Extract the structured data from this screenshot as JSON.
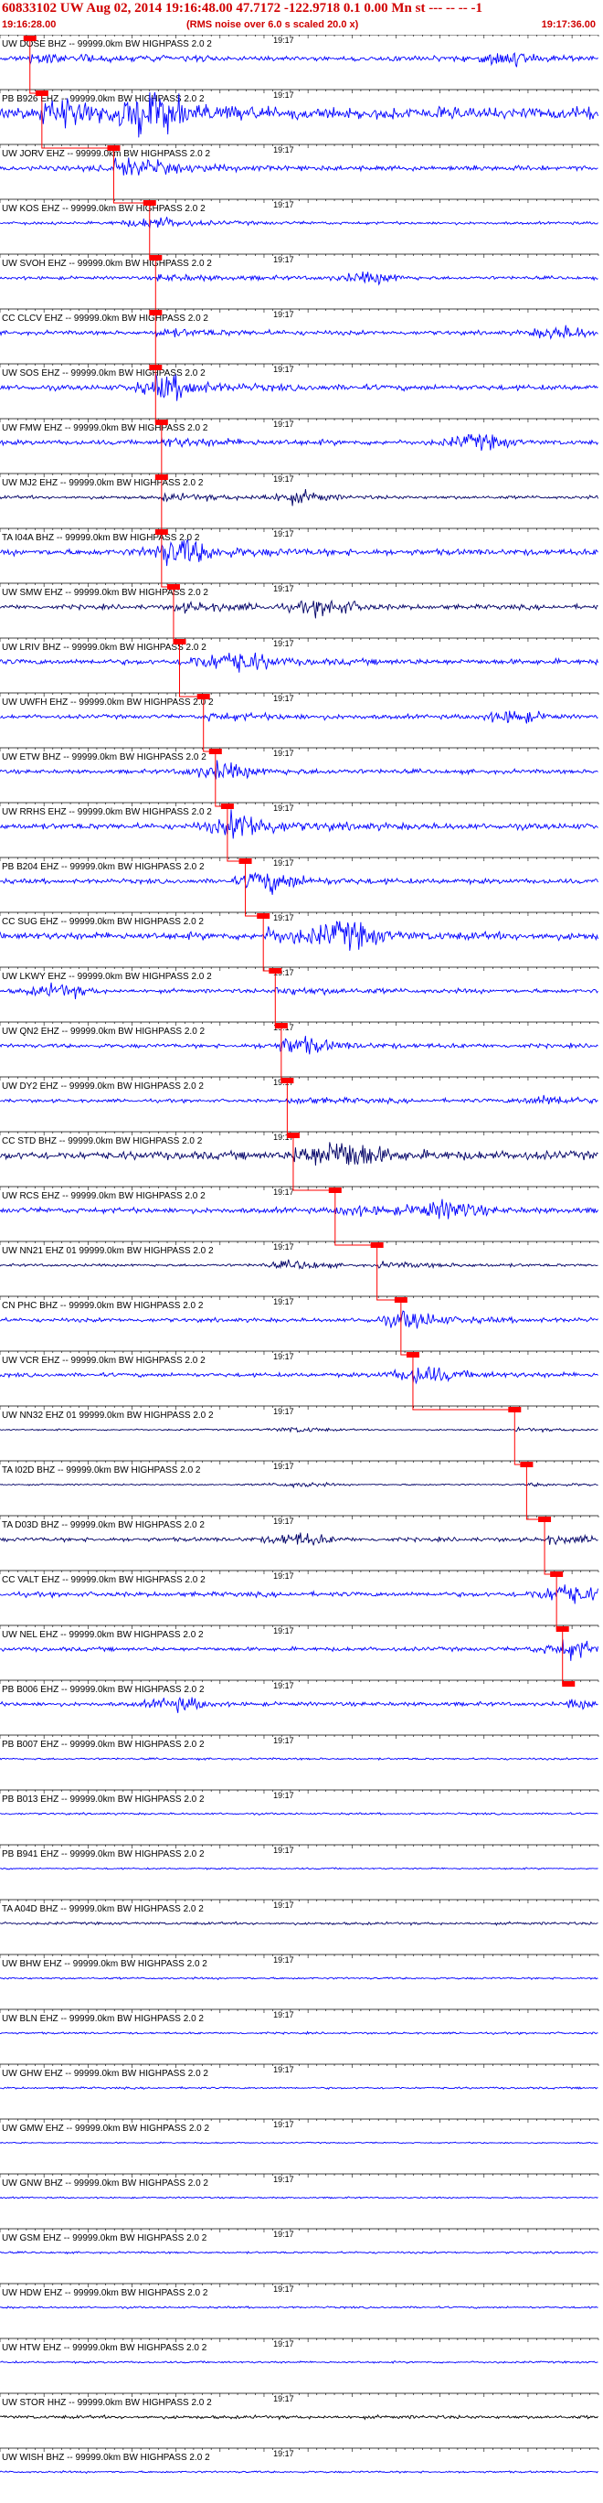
{
  "header": {
    "title": "60833102 UW Aug 02, 2014 19:16:48.00   47.7172 -122.9718  0.1 0.00 Mn st --- -- --   -1",
    "start_time": "19:16:28.00",
    "rms_note": "(RMS noise over 6.0 s scaled 20.0 x)",
    "end_time": "19:17:36.00"
  },
  "colors": {
    "trace_blue": "#0000ff",
    "trace_dark": "#000066",
    "trace_black": "#000000",
    "pick_red": "#ff0000",
    "header_red": "#d00000"
  },
  "chart_data": {
    "type": "line",
    "title": "",
    "xlabel": "",
    "ylabel": "",
    "time_axis": {
      "start": "19:16:28.00",
      "end": "19:17:36.00",
      "mid_label": "19:17"
    },
    "channels": [
      {
        "label": "UW DOSE BHZ -- 99999.0km BW  HIGHPASS  2.0  2",
        "color": "blue",
        "pick_fraction": 0.05,
        "burst_fraction": 0.84,
        "amplitude": 0.35
      },
      {
        "label": "PB B926 EHZ -- 99999.0km BW  HIGHPASS  2.0  2",
        "color": "blue",
        "pick_fraction": 0.07,
        "burst_fraction": 0.26,
        "amplitude": 0.9
      },
      {
        "label": "UW JORV EHZ -- 99999.0km BW  HIGHPASS  2.0  2",
        "color": "blue",
        "pick_fraction": 0.19,
        "burst_fraction": 0.22,
        "amplitude": 0.35
      },
      {
        "label": "UW KOS EHZ -- 99999.0km BW  HIGHPASS  2.0  2",
        "color": "blue",
        "pick_fraction": 0.25,
        "burst_fraction": 0.25,
        "amplitude": 0.2
      },
      {
        "label": "UW SVOH EHZ -- 99999.0km BW  HIGHPASS  2.0  2",
        "color": "blue",
        "pick_fraction": 0.26,
        "burst_fraction": 0.62,
        "amplitude": 0.25
      },
      {
        "label": "CC CLCV EHZ -- 99999.0km BW  HIGHPASS  2.0  2",
        "color": "blue",
        "pick_fraction": 0.26,
        "burst_fraction": 0.94,
        "amplitude": 0.3
      },
      {
        "label": "UW SOS EHZ -- 99999.0km BW  HIGHPASS  2.0  2",
        "color": "blue",
        "pick_fraction": 0.26,
        "burst_fraction": 0.28,
        "amplitude": 0.4
      },
      {
        "label": "UW FMW EHZ -- 99999.0km BW  HIGHPASS  2.0  2",
        "color": "blue",
        "pick_fraction": 0.27,
        "burst_fraction": 0.8,
        "amplitude": 0.35
      },
      {
        "label": "UW MJ2 EHZ -- 99999.0km BW  HIGHPASS  2.0  2",
        "color": "dark",
        "pick_fraction": 0.27,
        "burst_fraction": 0.5,
        "amplitude": 0.25
      },
      {
        "label": "TA I04A BHZ -- 99999.0km BW  HIGHPASS  2.0  2",
        "color": "blue",
        "pick_fraction": 0.27,
        "burst_fraction": 0.3,
        "amplitude": 0.45
      },
      {
        "label": "UW SMW EHZ -- 99999.0km BW  HIGHPASS  2.0  2",
        "color": "dark",
        "pick_fraction": 0.29,
        "burst_fraction": 0.55,
        "amplitude": 0.35
      },
      {
        "label": "UW LRIV BHZ -- 99999.0km BW  HIGHPASS  2.0  2",
        "color": "blue",
        "pick_fraction": 0.3,
        "burst_fraction": 0.4,
        "amplitude": 0.4
      },
      {
        "label": "UW UWFH EHZ -- 99999.0km BW  HIGHPASS  2.0  2",
        "color": "blue",
        "pick_fraction": 0.34,
        "burst_fraction": 0.86,
        "amplitude": 0.3
      },
      {
        "label": "UW ETW BHZ -- 99999.0km BW  HIGHPASS  2.0  2",
        "color": "blue",
        "pick_fraction": 0.36,
        "burst_fraction": 0.36,
        "amplitude": 0.3
      },
      {
        "label": "UW RRHS EHZ -- 99999.0km BW  HIGHPASS  2.0  2",
        "color": "blue",
        "pick_fraction": 0.38,
        "burst_fraction": 0.4,
        "amplitude": 0.45
      },
      {
        "label": "PB B204 EHZ -- 99999.0km BW  HIGHPASS  2.0  2",
        "color": "blue",
        "pick_fraction": 0.41,
        "burst_fraction": 0.45,
        "amplitude": 0.35
      },
      {
        "label": "CC SUG EHZ -- 99999.0km BW  HIGHPASS  2.0  2",
        "color": "blue",
        "pick_fraction": 0.44,
        "burst_fraction": 0.58,
        "amplitude": 0.55
      },
      {
        "label": "UW LKWY EHZ -- 99999.0km BW  HIGHPASS  2.0  2",
        "color": "blue",
        "pick_fraction": 0.46,
        "burst_fraction": 0.1,
        "amplitude": 0.3
      },
      {
        "label": "UW QN2 EHZ -- 99999.0km BW  HIGHPASS  2.0  2",
        "color": "blue",
        "pick_fraction": 0.47,
        "burst_fraction": 0.5,
        "amplitude": 0.3
      },
      {
        "label": "UW DY2 EHZ -- 99999.0km BW  HIGHPASS  2.0  2",
        "color": "blue",
        "pick_fraction": 0.48,
        "burst_fraction": 0.92,
        "amplitude": 0.25
      },
      {
        "label": "CC STD BHZ -- 99999.0km BW  HIGHPASS  2.0  2",
        "color": "dark",
        "pick_fraction": 0.49,
        "burst_fraction": 0.58,
        "amplitude": 0.6
      },
      {
        "label": "UW RCS EHZ -- 99999.0km BW  HIGHPASS  2.0  2",
        "color": "blue",
        "pick_fraction": 0.56,
        "burst_fraction": 0.75,
        "amplitude": 0.4
      },
      {
        "label": "UW NN21 EHZ 01 99999.0km BW  HIGHPASS  2.0  2",
        "color": "dark",
        "pick_fraction": 0.63,
        "burst_fraction": 0.5,
        "amplitude": 0.2
      },
      {
        "label": "CN PHC BHZ -- 99999.0km BW  HIGHPASS  2.0  2",
        "color": "blue",
        "pick_fraction": 0.67,
        "burst_fraction": 0.68,
        "amplitude": 0.3
      },
      {
        "label": "UW VCR EHZ -- 99999.0km BW  HIGHPASS  2.0  2",
        "color": "blue",
        "pick_fraction": 0.69,
        "burst_fraction": 0.7,
        "amplitude": 0.3
      },
      {
        "label": "UW NN32 EHZ 01 99999.0km BW  HIGHPASS  2.0  2",
        "color": "dark",
        "pick_fraction": 0.86,
        "burst_fraction": 0.5,
        "amplitude": 0.12
      },
      {
        "label": "TA I02D BHZ -- 99999.0km BW  HIGHPASS  2.0  2",
        "color": "dark",
        "pick_fraction": 0.88,
        "burst_fraction": 0.5,
        "amplitude": 0.12
      },
      {
        "label": "TA D03D BHZ -- 99999.0km BW  HIGHPASS  2.0  2",
        "color": "dark",
        "pick_fraction": 0.91,
        "burst_fraction": 0.5,
        "amplitude": 0.3
      },
      {
        "label": "CC VALT EHZ -- 99999.0km BW  HIGHPASS  2.0  2",
        "color": "blue",
        "pick_fraction": 0.93,
        "burst_fraction": 0.94,
        "amplitude": 0.35
      },
      {
        "label": "UW NEL EHZ -- 99999.0km BW  HIGHPASS  2.0  2",
        "color": "blue",
        "pick_fraction": 0.94,
        "burst_fraction": 0.95,
        "amplitude": 0.3
      },
      {
        "label": "PB B006 EHZ -- 99999.0km BW  HIGHPASS  2.0  2",
        "color": "blue",
        "pick_fraction": 0.95,
        "burst_fraction": 0.3,
        "amplitude": 0.3
      },
      {
        "label": "PB B007 EHZ -- 99999.0km BW  HIGHPASS  2.0  2",
        "color": "blue",
        "pick_fraction": null,
        "burst_fraction": null,
        "amplitude": 0.15
      },
      {
        "label": "PB B013 EHZ -- 99999.0km BW  HIGHPASS  2.0  2",
        "color": "blue",
        "pick_fraction": null,
        "burst_fraction": null,
        "amplitude": 0.15
      },
      {
        "label": "PB B941 EHZ -- 99999.0km BW  HIGHPASS  2.0  2",
        "color": "blue",
        "pick_fraction": null,
        "burst_fraction": null,
        "amplitude": 0.12
      },
      {
        "label": "TA A04D BHZ -- 99999.0km BW  HIGHPASS  2.0  2",
        "color": "dark",
        "pick_fraction": null,
        "burst_fraction": null,
        "amplitude": 0.2
      },
      {
        "label": "UW BHW EHZ -- 99999.0km BW  HIGHPASS  2.0  2",
        "color": "blue",
        "pick_fraction": null,
        "burst_fraction": null,
        "amplitude": 0.15
      },
      {
        "label": "UW BLN EHZ -- 99999.0km BW  HIGHPASS  2.0  2",
        "color": "blue",
        "pick_fraction": null,
        "burst_fraction": null,
        "amplitude": 0.15
      },
      {
        "label": "UW GHW EHZ -- 99999.0km BW  HIGHPASS  2.0  2",
        "color": "blue",
        "pick_fraction": null,
        "burst_fraction": null,
        "amplitude": 0.15
      },
      {
        "label": "UW GMW EHZ -- 99999.0km BW  HIGHPASS  2.0  2",
        "color": "blue",
        "pick_fraction": null,
        "burst_fraction": null,
        "amplitude": 0.1
      },
      {
        "label": "UW GNW BHZ -- 99999.0km BW  HIGHPASS  2.0  2",
        "color": "blue",
        "pick_fraction": null,
        "burst_fraction": null,
        "amplitude": 0.12
      },
      {
        "label": "UW GSM EHZ -- 99999.0km BW  HIGHPASS  2.0  2",
        "color": "blue",
        "pick_fraction": null,
        "burst_fraction": null,
        "amplitude": 0.15
      },
      {
        "label": "UW HDW EHZ -- 99999.0km BW  HIGHPASS  2.0  2",
        "color": "blue",
        "pick_fraction": null,
        "burst_fraction": null,
        "amplitude": 0.15
      },
      {
        "label": "UW HTW EHZ -- 99999.0km BW  HIGHPASS  2.0  2",
        "color": "blue",
        "pick_fraction": null,
        "burst_fraction": null,
        "amplitude": 0.15
      },
      {
        "label": "UW STOR HHZ -- 99999.0km BW  HIGHPASS  2.0  2",
        "color": "black",
        "pick_fraction": null,
        "burst_fraction": null,
        "amplitude": 0.25
      },
      {
        "label": "UW WISH BHZ -- 99999.0km BW  HIGHPASS  2.0  2",
        "color": "blue",
        "pick_fraction": null,
        "burst_fraction": null,
        "amplitude": 0.15
      }
    ]
  }
}
